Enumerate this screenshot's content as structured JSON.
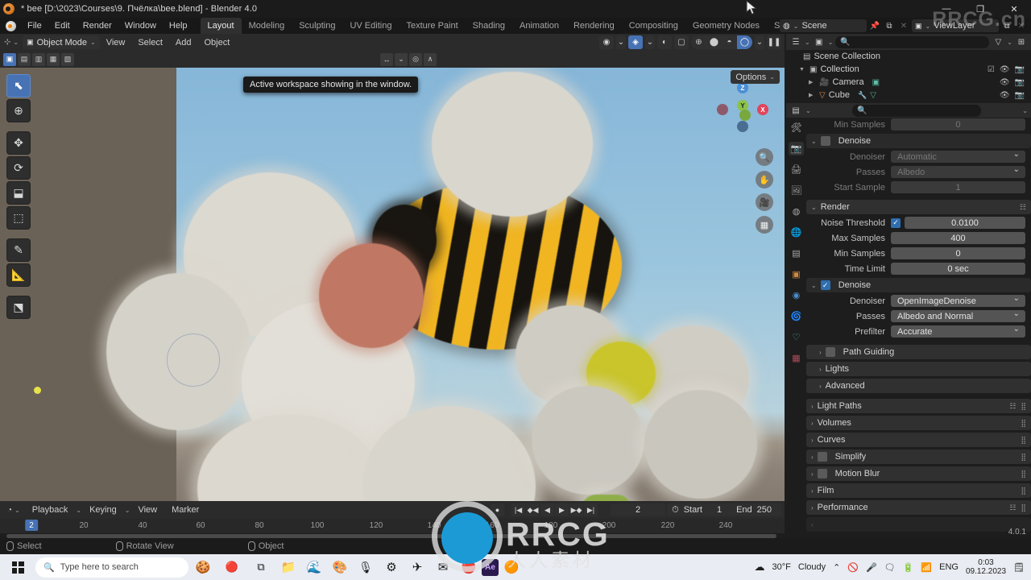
{
  "window": {
    "title": "* bee [D:\\2023\\Courses\\9. Пчёлка\\bee.blend] - Blender 4.0",
    "minimize": "—",
    "maximize": "❐",
    "close": "✕"
  },
  "topbar": {
    "menus": [
      "File",
      "Edit",
      "Render",
      "Window",
      "Help"
    ],
    "workspaces": [
      {
        "label": "Layout",
        "active": true
      },
      {
        "label": "Modeling",
        "active": false
      },
      {
        "label": "Sculpting",
        "active": false
      },
      {
        "label": "UV Editing",
        "active": false
      },
      {
        "label": "Texture Paint",
        "active": false
      },
      {
        "label": "Shading",
        "active": false
      },
      {
        "label": "Animation",
        "active": false
      },
      {
        "label": "Rendering",
        "active": false
      },
      {
        "label": "Compositing",
        "active": false
      },
      {
        "label": "Geometry Nodes",
        "active": false
      },
      {
        "label": "Scripting",
        "active": false
      }
    ],
    "add_workspace": "+",
    "scene_name": "Scene",
    "view_layer_name": "ViewLayer",
    "scene_icon": "scene-icon",
    "pin_icon": "pin-icon",
    "copy_icon": "copy-icon",
    "remove_icon": "x-icon"
  },
  "viewport": {
    "editor_type_icon": "editor-type-icon",
    "mode": "Object Mode",
    "menus": [
      "View",
      "Select",
      "Add",
      "Object"
    ],
    "tooltip": "Active workspace showing in the window.",
    "options_label": "Options",
    "gizmo_axes": [
      {
        "label": "Z",
        "color": "#4b8fd6"
      },
      {
        "label": "Y",
        "color": "#8bc34a"
      },
      {
        "label": "X",
        "color": "#e0455b"
      }
    ],
    "nav_buttons": [
      "zoom-icon",
      "pan-hand-icon",
      "camera-view-icon",
      "ortho-persp-icon"
    ],
    "left_tools": [
      "tweak-select-tool",
      "cursor-tool",
      "move-tool",
      "rotate-tool",
      "scale-tool",
      "transform-tool",
      "annotate-tool",
      "measure-tool",
      "add-cube-tool"
    ],
    "select_modes": [
      "set",
      "extend",
      "subtract",
      "invert",
      "intersect"
    ],
    "shading_modes": [
      "wireframe",
      "solid",
      "material-preview",
      "rendered"
    ],
    "active_shading": "rendered",
    "overlay_on": true,
    "xray_on": false,
    "pause_icon": "pause-icon"
  },
  "timeline": {
    "editor_icon": "timeline-icon",
    "menus": [
      "Playback",
      "Keying",
      "View",
      "Marker"
    ],
    "record_icon": "record-icon",
    "transport": [
      "jump-start",
      "prev-keyframe",
      "play-reverse",
      "play",
      "next-keyframe",
      "jump-end"
    ],
    "current_frame": "2",
    "start_label": "Start",
    "start_value": "1",
    "end_label": "End",
    "end_value": "250",
    "ticks": [
      "20",
      "40",
      "60",
      "80",
      "100",
      "120",
      "140",
      "160",
      "180",
      "200",
      "220",
      "240"
    ],
    "playhead_frame": "2"
  },
  "outliner": {
    "display_mode_icon": "outliner-display-icon",
    "scene_filter_icon": "scene-filter-icon",
    "search_placeholder": "",
    "filter_icon": "filter-icon",
    "new_collection_icon": "new-collection-icon",
    "rows": [
      {
        "label": "Scene Collection",
        "indent": 0,
        "icon": "scene-collection-icon",
        "expander": "",
        "checkbox": false,
        "eye": false,
        "camera": false
      },
      {
        "label": "Collection",
        "indent": 1,
        "icon": "collection-icon",
        "expander": "▼",
        "checkbox": true,
        "eye": true,
        "camera": true
      },
      {
        "label": "Camera",
        "indent": 2,
        "icon": "camera-object-icon",
        "expander": "▶",
        "checkbox": false,
        "eye": true,
        "camera": true
      },
      {
        "label": "Cube",
        "indent": 2,
        "icon": "mesh-object-icon",
        "expander": "▶",
        "checkbox": false,
        "eye": true,
        "camera": true
      }
    ]
  },
  "properties": {
    "editor_icon": "properties-editor-icon",
    "search_placeholder": "",
    "tabs": [
      "tool-icon",
      "render-icon",
      "output-icon",
      "view-layer-icon",
      "scene-icon",
      "world-icon",
      "collection-icon",
      "object-icon",
      "modifier-icon",
      "physics-icon",
      "constraint-icon",
      "data-icon",
      "material-icon"
    ],
    "active_tab_index": 1,
    "version": "4.0.1",
    "viewport_denoise": {
      "min_samples_label": "Min Samples",
      "min_samples_value": "0",
      "title": "Denoise",
      "checked": false,
      "rows": [
        {
          "label": "Denoiser",
          "value": "Automatic",
          "type": "dropdown"
        },
        {
          "label": "Passes",
          "value": "Albedo",
          "type": "dropdown"
        },
        {
          "label": "Start Sample",
          "value": "1",
          "type": "number"
        }
      ]
    },
    "render_panel": {
      "title": "Render",
      "noise_threshold_label": "Noise Threshold",
      "noise_threshold_checked": true,
      "noise_threshold_value": "0.0100",
      "rows": [
        {
          "label": "Max Samples",
          "value": "400"
        },
        {
          "label": "Min Samples",
          "value": "0"
        },
        {
          "label": "Time Limit",
          "value": "0 sec"
        }
      ]
    },
    "render_denoise": {
      "title": "Denoise",
      "checked": true,
      "rows": [
        {
          "label": "Denoiser",
          "value": "OpenImageDenoise"
        },
        {
          "label": "Passes",
          "value": "Albedo and Normal"
        },
        {
          "label": "Prefilter",
          "value": "Accurate"
        }
      ]
    },
    "collapsed_panels": [
      {
        "label": "Path Guiding",
        "checkbox": true,
        "indent": true,
        "preset": false
      },
      {
        "label": "Lights",
        "checkbox": false,
        "indent": true,
        "preset": false
      },
      {
        "label": "Advanced",
        "checkbox": false,
        "indent": true,
        "preset": false
      },
      {
        "label": "Light Paths",
        "checkbox": false,
        "indent": false,
        "preset": true
      },
      {
        "label": "Volumes",
        "checkbox": false,
        "indent": false,
        "preset": false
      },
      {
        "label": "Curves",
        "checkbox": false,
        "indent": false,
        "preset": false
      },
      {
        "label": "Simplify",
        "checkbox": true,
        "indent": false,
        "preset": false
      },
      {
        "label": "Motion Blur",
        "checkbox": true,
        "indent": false,
        "preset": false
      },
      {
        "label": "Film",
        "checkbox": false,
        "indent": false,
        "preset": false
      },
      {
        "label": "Performance",
        "checkbox": false,
        "indent": false,
        "preset": true
      }
    ]
  },
  "statusbar": {
    "items": [
      {
        "icon": "mouse-left-icon",
        "label": "Select"
      },
      {
        "icon": "mouse-middle-icon",
        "label": "Rotate View"
      },
      {
        "icon": "mouse-right-icon",
        "label": "Object"
      }
    ]
  },
  "taskbar": {
    "search_placeholder": "Type here to search",
    "apps": [
      "task-view-icon",
      "file-explorer-icon",
      "edge-icon",
      "chrome-icon",
      "voice-recorder-icon",
      "settings-icon",
      "telegram-icon",
      "mail-icon",
      "browser-icon",
      "after-effects-icon",
      "blender-icon"
    ],
    "weather_temp": "30°F",
    "weather_desc": "Cloudy",
    "language": "ENG",
    "time": "0:03",
    "date": "09.12.2023",
    "tray_icons": [
      "chevron-up-icon",
      "no-notify-icon",
      "microphone-icon",
      "teams-icon",
      "battery-icon",
      "wifi-icon"
    ],
    "notification_icon": "notification-center-icon"
  },
  "watermark": {
    "text": "RRCG",
    "subtext": "人人素材",
    "corner_text": "RRCG.cn"
  }
}
